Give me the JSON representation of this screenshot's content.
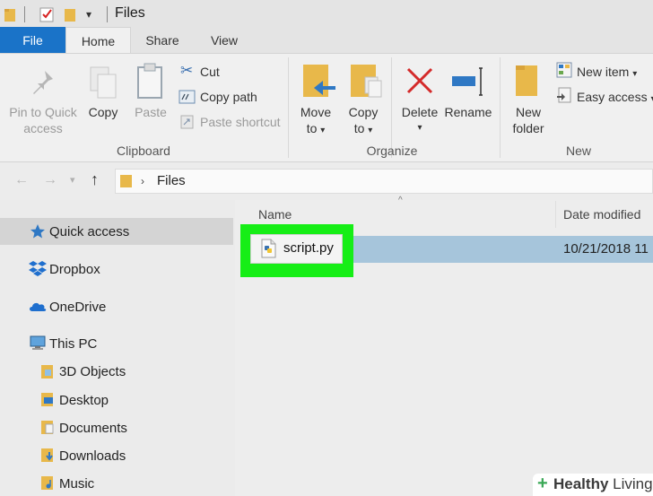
{
  "window": {
    "title": "Files"
  },
  "tabs": {
    "file": "File",
    "home": "Home",
    "share": "Share",
    "view": "View"
  },
  "ribbon": {
    "clipboard": {
      "pin_line1": "Pin to Quick",
      "pin_line2": "access",
      "copy": "Copy",
      "paste": "Paste",
      "cut": "Cut",
      "copy_path": "Copy path",
      "paste_shortcut": "Paste shortcut",
      "group": "Clipboard"
    },
    "organize": {
      "move_line1": "Move",
      "move_line2": "to",
      "copy_line1": "Copy",
      "copy_line2": "to",
      "delete": "Delete",
      "rename": "Rename",
      "group": "Organize"
    },
    "new": {
      "folder_line1": "New",
      "folder_line2": "folder",
      "new_item": "New item",
      "easy_access": "Easy access",
      "group": "New"
    }
  },
  "address": {
    "path": "Files"
  },
  "nav": {
    "quick_access": "Quick access",
    "dropbox": "Dropbox",
    "onedrive": "OneDrive",
    "this_pc": "This PC",
    "objects_3d": "3D Objects",
    "desktop": "Desktop",
    "documents": "Documents",
    "downloads": "Downloads",
    "music": "Music"
  },
  "content": {
    "col_name": "Name",
    "col_date": "Date modified",
    "file": {
      "name": "script.py",
      "date": "10/21/2018 11"
    }
  },
  "watermark": {
    "brand_bold": "Healthy",
    "brand_light": " Living"
  },
  "colors": {
    "accent": "#1a73c8",
    "highlight": "#16ee16",
    "selection": "#a6c5db"
  }
}
